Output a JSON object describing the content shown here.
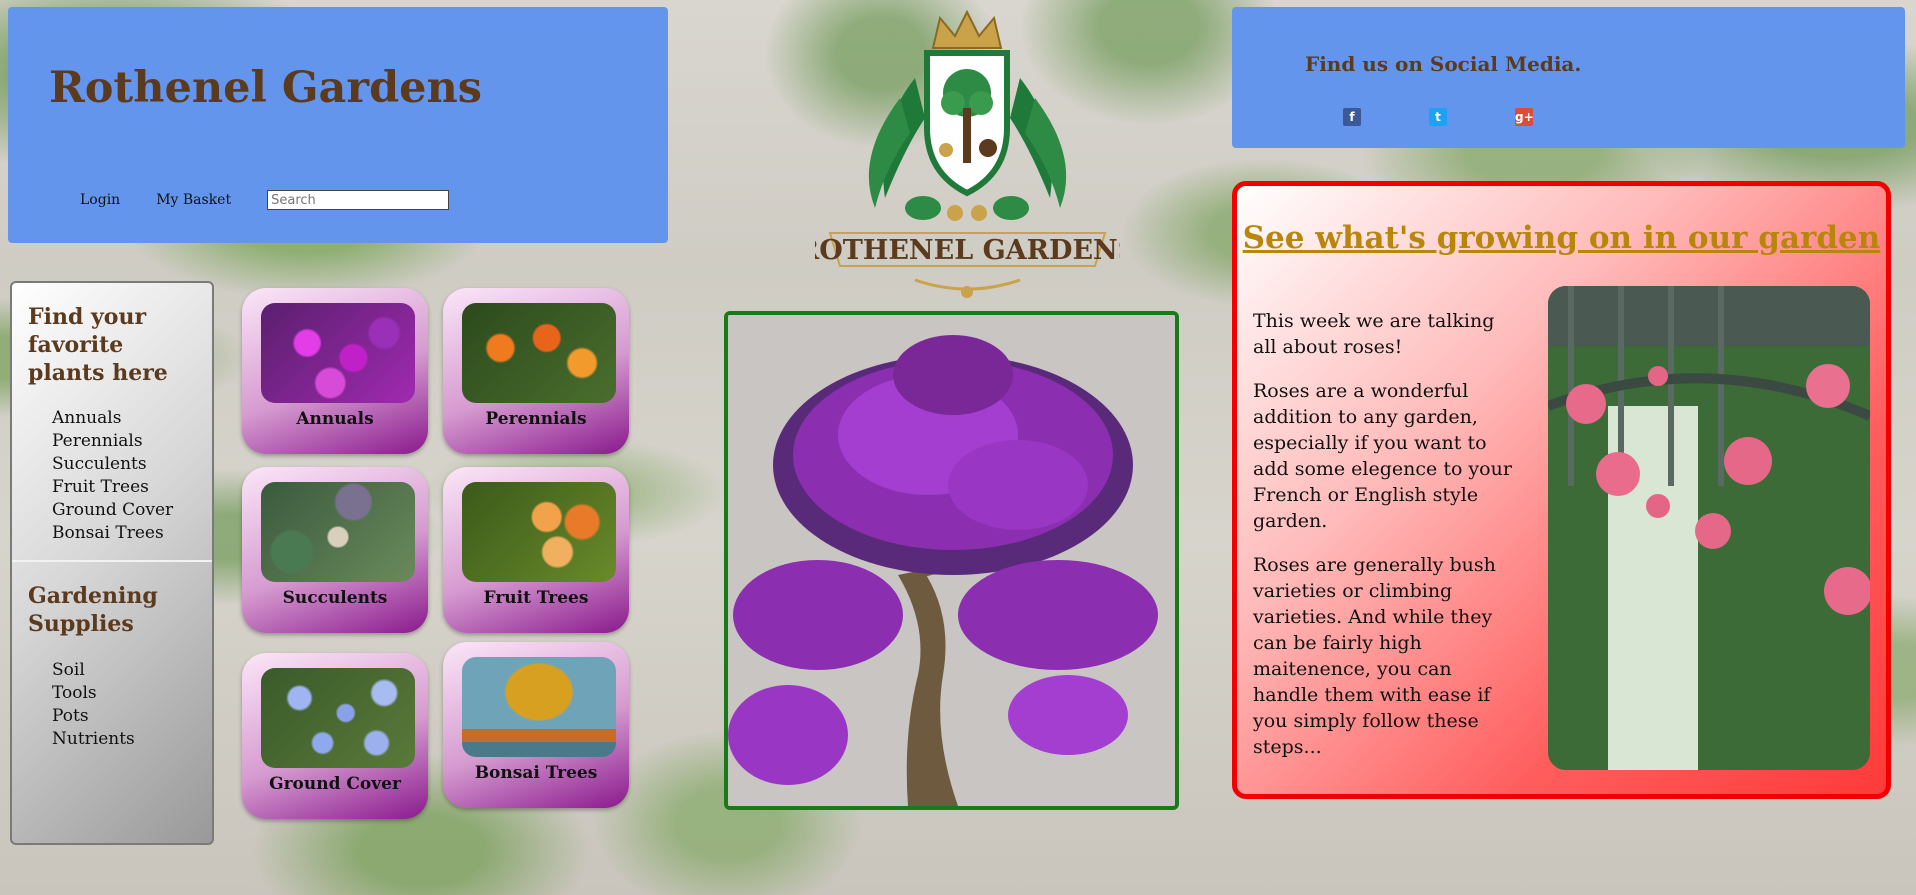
{
  "header": {
    "title": "Rothenel Gardens",
    "nav": {
      "login_label": "Login",
      "basket_label": "My Basket",
      "search_placeholder": "Search"
    }
  },
  "logo": {
    "alt_text": "Rothenel Gardens",
    "icon": "crest-logo"
  },
  "social": {
    "title": "Find us on Social Media.",
    "icons": [
      {
        "name": "facebook-icon",
        "glyph": "f",
        "color": "#3b5998"
      },
      {
        "name": "twitter-icon",
        "glyph": "t",
        "color": "#1da1f2"
      },
      {
        "name": "google-plus-icon",
        "glyph": "g+",
        "color": "#dd4b39"
      }
    ]
  },
  "sidebar": {
    "plants_heading": "Find your favorite plants here",
    "plants": [
      "Annuals",
      "Perennials",
      "Succulents",
      "Fruit Trees",
      "Ground Cover",
      "Bonsai Trees"
    ],
    "supplies_heading": "Gardening Supplies",
    "supplies": [
      "Soil",
      "Tools",
      "Pots",
      "Nutrients"
    ]
  },
  "tiles": [
    {
      "label": "Annuals",
      "image": "purple-flowers"
    },
    {
      "label": "Perennials",
      "image": "orange-lilies"
    },
    {
      "label": "Succulents",
      "image": "succulent-bed"
    },
    {
      "label": "Fruit Trees",
      "image": "peaches"
    },
    {
      "label": "Ground Cover",
      "image": "blue-ground-flowers"
    },
    {
      "label": "Bonsai Trees",
      "image": "yellow-bonsai"
    }
  ],
  "feature": {
    "image": "purple-bougainvillea-bonsai"
  },
  "blog": {
    "title": "See what's growing on in our garden",
    "paragraphs": [
      "This week we are talking all about roses!",
      "Roses are a wonderful addition to any garden, especially if you want to add some elegence to your French or English style garden.",
      "Roses are generally bush varieties or climbing varieties. And while they can be fairly high maitenence, you can handle them with ease if you simply follow these steps..."
    ],
    "image": "climbing-roses"
  },
  "colors": {
    "header_bg": "#6495ed",
    "title_brown": "#5c3a1e",
    "blog_title_gold": "#b8860b",
    "blog_border_red": "#f00000",
    "photo_border_green": "#1a7a1a",
    "tile_purple": "#8a1a8e"
  }
}
